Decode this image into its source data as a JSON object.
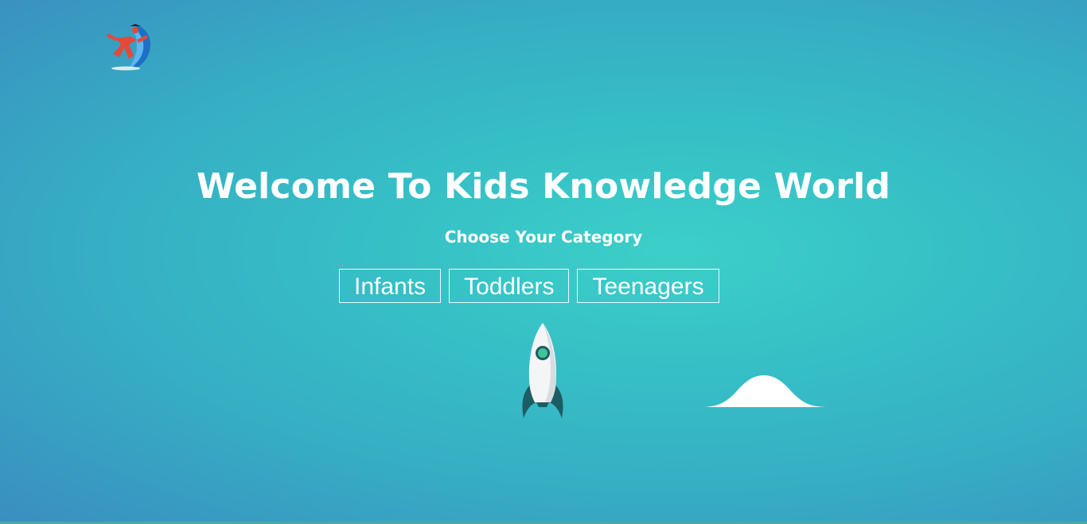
{
  "logo": {
    "icon": "kid-running-logo-icon"
  },
  "hero": {
    "title": "Welcome To Kids Knowledge World",
    "subtitle": "Choose Your Category"
  },
  "categories": [
    {
      "label": "Infants"
    },
    {
      "label": "Toddlers"
    },
    {
      "label": "Teenagers"
    }
  ],
  "illustrations": {
    "rocket": "rocket-icon",
    "cloud": "cloud-icon"
  },
  "colors": {
    "background_center": "#3ccfc9",
    "background_edge": "#3a8ec0",
    "text": "#ffffff",
    "button_border": "#ffffff"
  }
}
